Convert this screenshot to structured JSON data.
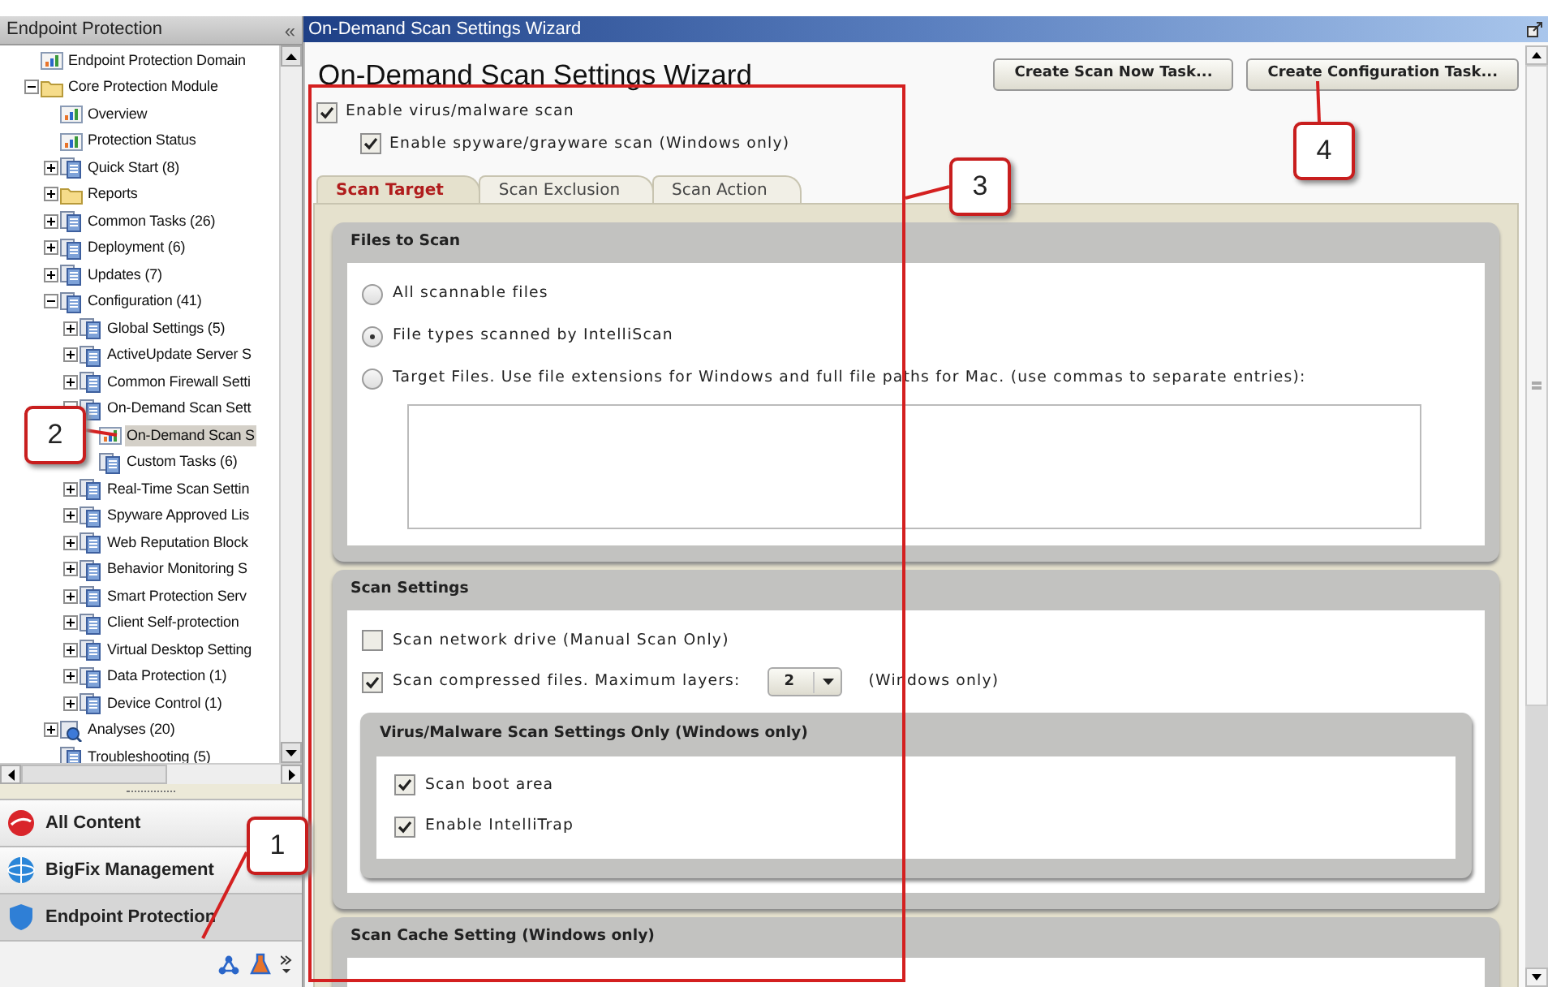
{
  "sidebar": {
    "title": "Endpoint Protection",
    "collapse_glyph": "«",
    "tree": [
      {
        "label": "Endpoint Protection Domain",
        "kind": "chart",
        "selected": false
      },
      {
        "label": "Core Protection Module",
        "kind": "folder",
        "expanded": true,
        "selected": false,
        "children": [
          {
            "label": "Overview",
            "kind": "chart",
            "selected": false
          },
          {
            "label": "Protection Status",
            "kind": "chart",
            "selected": false
          },
          {
            "label": "Quick Start (8)",
            "kind": "doc",
            "expanded": false,
            "selected": false
          },
          {
            "label": "Reports",
            "kind": "folder",
            "expanded": false,
            "selected": false
          },
          {
            "label": "Common Tasks (26)",
            "kind": "doc",
            "expanded": false,
            "selected": false
          },
          {
            "label": "Deployment (6)",
            "kind": "doc",
            "expanded": false,
            "selected": false
          },
          {
            "label": "Updates (7)",
            "kind": "doc",
            "expanded": false,
            "selected": false
          },
          {
            "label": "Configuration (41)",
            "kind": "doc",
            "expanded": true,
            "selected": false,
            "children": [
              {
                "label": "Global Settings (5)",
                "kind": "doc",
                "expanded": false,
                "selected": false
              },
              {
                "label": "ActiveUpdate Server S",
                "kind": "doc",
                "expanded": false,
                "selected": false
              },
              {
                "label": "Common Firewall Setti",
                "kind": "doc",
                "expanded": false,
                "selected": false
              },
              {
                "label": "On-Demand Scan Sett",
                "kind": "doc",
                "expanded": true,
                "selected": false,
                "children": [
                  {
                    "label": "On-Demand Scan S",
                    "kind": "chart",
                    "selected": true
                  },
                  {
                    "label": "Custom Tasks (6)",
                    "kind": "doc",
                    "selected": false
                  }
                ]
              },
              {
                "label": "Real-Time Scan Settin",
                "kind": "doc",
                "expanded": false,
                "selected": false
              },
              {
                "label": "Spyware Approved Lis",
                "kind": "doc",
                "expanded": false,
                "selected": false
              },
              {
                "label": "Web Reputation Block",
                "kind": "doc",
                "expanded": false,
                "selected": false
              },
              {
                "label": "Behavior Monitoring S",
                "kind": "doc",
                "expanded": false,
                "selected": false
              },
              {
                "label": "Smart Protection Serv",
                "kind": "doc",
                "expanded": false,
                "selected": false
              },
              {
                "label": "Client Self-protection",
                "kind": "doc",
                "expanded": false,
                "selected": false
              },
              {
                "label": "Virtual Desktop Setting",
                "kind": "doc",
                "expanded": false,
                "selected": false
              },
              {
                "label": "Data Protection (1)",
                "kind": "doc",
                "expanded": false,
                "selected": false
              },
              {
                "label": "Device Control (1)",
                "kind": "doc",
                "expanded": false,
                "selected": false
              }
            ]
          },
          {
            "label": "Analyses (20)",
            "kind": "analysis",
            "expanded": false,
            "selected": false
          },
          {
            "label": "Troubleshooting (5)",
            "kind": "doc",
            "selected": false
          }
        ]
      }
    ],
    "nav": [
      {
        "label": "All Content",
        "kind": "trend",
        "selected": false
      },
      {
        "label": "BigFix Management",
        "kind": "globe",
        "selected": false
      },
      {
        "label": "Endpoint Protection",
        "kind": "shield",
        "selected": true
      }
    ]
  },
  "window": {
    "title": "On-Demand Scan Settings Wizard"
  },
  "main": {
    "heading": "On-Demand Scan Settings Wizard",
    "buttons": [
      "Create Scan Now Task...",
      "Create Configuration Task..."
    ],
    "options": [
      {
        "label": "Enable virus/malware scan",
        "checked": true
      },
      {
        "label": "Enable spyware/grayware scan (Windows only)",
        "checked": true
      }
    ],
    "tabs": [
      {
        "label": "Scan Target",
        "selected": true
      },
      {
        "label": "Scan Exclusion",
        "selected": false
      },
      {
        "label": "Scan Action",
        "selected": false
      }
    ],
    "sections": [
      {
        "title": "Files to Scan",
        "items": [
          {
            "kind": "radio",
            "label": "All scannable files",
            "selected": false
          },
          {
            "kind": "radio",
            "label": "File types scanned by IntelliScan",
            "selected": true
          },
          {
            "kind": "radio",
            "label": "Target Files. Use file extensions for Windows and full file paths for Mac. (use commas to separate entries):",
            "selected": false
          },
          {
            "kind": "textarea"
          }
        ]
      },
      {
        "title": "Scan Settings",
        "items": [
          {
            "kind": "checkbox",
            "label": "Scan network drive (Manual Scan Only)",
            "checked": false
          },
          {
            "kind": "checkbox_dropdown",
            "label": "Scan compressed files. Maximum layers:",
            "checked": true,
            "value": "2",
            "note": "(Windows only)"
          },
          {
            "kind": "group",
            "title": "Virus/Malware Scan Settings Only (Windows only)",
            "items": [
              {
                "kind": "checkbox",
                "label": "Scan boot area",
                "checked": true
              },
              {
                "kind": "checkbox",
                "label": "Enable IntelliTrap",
                "checked": true
              }
            ]
          }
        ]
      },
      {
        "title": "Scan Cache Setting (Windows only)"
      }
    ]
  },
  "callouts": [
    {
      "label": "1"
    },
    {
      "label": "2"
    },
    {
      "label": "3"
    },
    {
      "label": "4"
    }
  ]
}
